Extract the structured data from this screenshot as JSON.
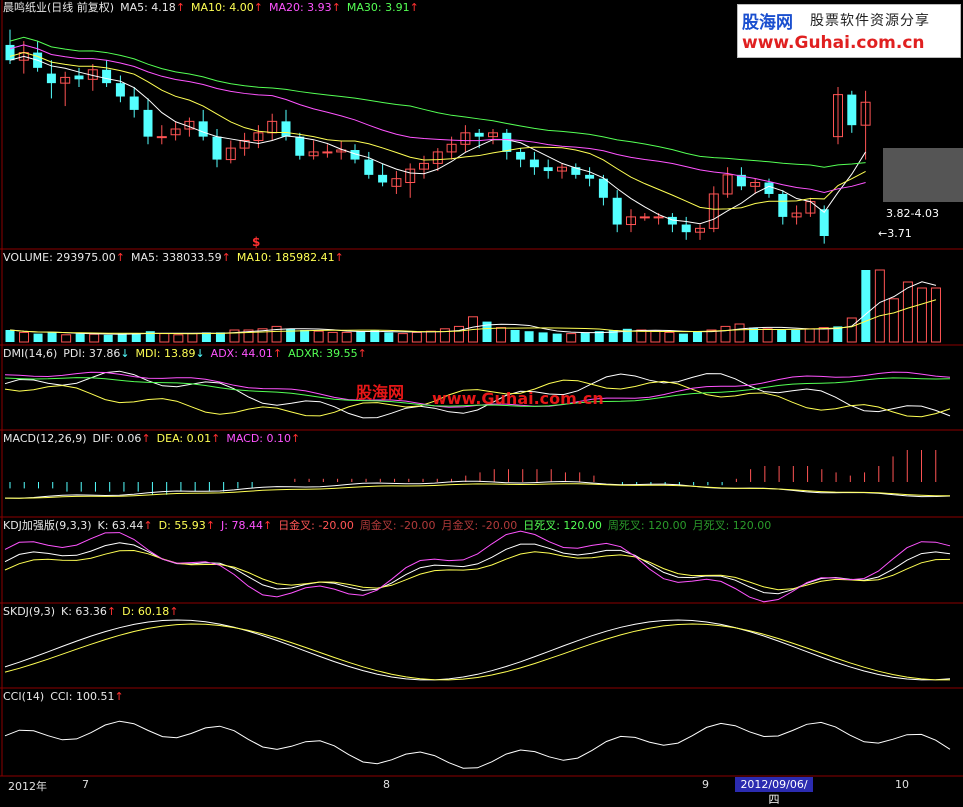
{
  "panels": {
    "main": {
      "items": [
        {
          "text": "晨鸣纸业(日线 前复权)",
          "cls": "c-white"
        },
        {
          "text": "MA5: 4.18",
          "cls": "c-white",
          "arrow": "up"
        },
        {
          "text": "MA10: 4.00",
          "cls": "c-yellow",
          "arrow": "up"
        },
        {
          "text": "MA20: 3.93",
          "cls": "c-magenta",
          "arrow": "up"
        },
        {
          "text": "MA30: 3.91",
          "cls": "c-green",
          "arrow": "up"
        }
      ]
    },
    "volume": {
      "items": [
        {
          "text": "VOLUME: 293975.00",
          "cls": "c-white",
          "arrow": "up"
        },
        {
          "text": "MA5: 338033.59",
          "cls": "c-white",
          "arrow": "up"
        },
        {
          "text": "MA10: 185982.41",
          "cls": "c-yellow",
          "arrow": "up"
        }
      ]
    },
    "dmi": {
      "items": [
        {
          "text": "DMI(14,6)",
          "cls": "c-white"
        },
        {
          "text": "PDI: 37.86",
          "cls": "c-white",
          "arrow": "down"
        },
        {
          "text": "MDI: 13.89",
          "cls": "c-yellow",
          "arrow": "down"
        },
        {
          "text": "ADX: 44.01",
          "cls": "c-magenta",
          "arrow": "up"
        },
        {
          "text": "ADXR: 39.55",
          "cls": "c-green",
          "arrow": "up"
        }
      ]
    },
    "macd": {
      "items": [
        {
          "text": "MACD(12,26,9)",
          "cls": "c-white"
        },
        {
          "text": "DIF: 0.06",
          "cls": "c-white",
          "arrow": "up"
        },
        {
          "text": "DEA: 0.01",
          "cls": "c-yellow",
          "arrow": "up"
        },
        {
          "text": "MACD: 0.10",
          "cls": "c-magenta",
          "arrow": "up"
        }
      ]
    },
    "kdj": {
      "items": [
        {
          "text": "KDJ加强版(9,3,3)",
          "cls": "c-white"
        },
        {
          "text": "K: 63.44",
          "cls": "c-white",
          "arrow": "up"
        },
        {
          "text": "D: 55.93",
          "cls": "c-yellow",
          "arrow": "up"
        },
        {
          "text": "J: 78.44",
          "cls": "c-magenta",
          "arrow": "up"
        },
        {
          "text": "日金叉: -20.00",
          "cls": "c-red"
        },
        {
          "text": "周金叉: -20.00",
          "cls": "c-dred"
        },
        {
          "text": "月金叉: -20.00",
          "cls": "c-dred"
        },
        {
          "text": "日死叉: 120.00",
          "cls": "c-green"
        },
        {
          "text": "周死叉: 120.00",
          "cls": "c-dgreen"
        },
        {
          "text": "月死叉: 120.00",
          "cls": "c-dgreen"
        }
      ]
    },
    "skdj": {
      "items": [
        {
          "text": "SKDJ(9,3)",
          "cls": "c-white"
        },
        {
          "text": "K: 63.36",
          "cls": "c-white",
          "arrow": "up"
        },
        {
          "text": "D: 60.18",
          "cls": "c-yellow",
          "arrow": "up"
        }
      ]
    },
    "cci": {
      "items": [
        {
          "text": "CCI(14)",
          "cls": "c-white"
        },
        {
          "text": "CCI: 100.51",
          "cls": "c-white",
          "arrow": "up"
        }
      ]
    }
  },
  "annotations": {
    "high_low_label": "3.82-4.03",
    "low_label": "3.71",
    "dollar_marker": "$"
  },
  "watermark": {
    "logo_cn": "股海网",
    "logo_tag": "股票软件资源分享",
    "logo_url": "www.Guhai.com.cn",
    "mid_cn": "股海网",
    "mid_url": "www.Guhai.com.cn"
  },
  "x_axis": {
    "labels": [
      "2012年",
      "7",
      "8",
      "9",
      "10"
    ],
    "cursor_date": "2012/09/06/四"
  },
  "colors": {
    "up": "#ff5454",
    "down": "#54ffff",
    "ma5": "#ffffff",
    "ma10": "#ffff54",
    "ma20": "#ff54ff",
    "ma30": "#54ff54",
    "grid": "#8b0000"
  },
  "chart_data": [
    {
      "type": "candlestick",
      "title": "晨鸣纸业(日线 前复权)",
      "ohlc": [
        [
          4.6,
          4.68,
          4.5,
          4.52
        ],
        [
          4.52,
          4.62,
          4.45,
          4.56
        ],
        [
          4.56,
          4.62,
          4.46,
          4.48
        ],
        [
          4.45,
          4.52,
          4.32,
          4.4
        ],
        [
          4.4,
          4.46,
          4.28,
          4.43
        ],
        [
          4.44,
          4.48,
          4.38,
          4.42
        ],
        [
          4.42,
          4.5,
          4.36,
          4.47
        ],
        [
          4.47,
          4.52,
          4.38,
          4.4
        ],
        [
          4.4,
          4.44,
          4.3,
          4.33
        ],
        [
          4.33,
          4.38,
          4.22,
          4.26
        ],
        [
          4.26,
          4.32,
          4.08,
          4.12
        ],
        [
          4.12,
          4.18,
          4.08,
          4.12
        ],
        [
          4.13,
          4.2,
          4.1,
          4.16
        ],
        [
          4.16,
          4.22,
          4.12,
          4.2
        ],
        [
          4.2,
          4.26,
          4.1,
          4.12
        ],
        [
          4.12,
          4.16,
          3.96,
          4.0
        ],
        [
          4.0,
          4.1,
          3.98,
          4.06
        ],
        [
          4.06,
          4.14,
          4.02,
          4.1
        ],
        [
          4.1,
          4.18,
          4.06,
          4.14
        ],
        [
          4.14,
          4.24,
          4.1,
          4.2
        ],
        [
          4.2,
          4.26,
          4.1,
          4.12
        ],
        [
          4.12,
          4.14,
          4.0,
          4.02
        ],
        [
          4.02,
          4.1,
          4.0,
          4.04
        ],
        [
          4.04,
          4.08,
          4.01,
          4.04
        ],
        [
          4.04,
          4.1,
          4.0,
          4.05
        ],
        [
          4.05,
          4.08,
          3.98,
          4.0
        ],
        [
          4.0,
          4.04,
          3.9,
          3.92
        ],
        [
          3.92,
          3.98,
          3.86,
          3.88
        ],
        [
          3.86,
          3.94,
          3.82,
          3.9
        ],
        [
          3.88,
          3.98,
          3.8,
          3.95
        ],
        [
          3.95,
          4.02,
          3.9,
          3.98
        ],
        [
          3.98,
          4.06,
          3.94,
          4.04
        ],
        [
          4.04,
          4.12,
          4.0,
          4.08
        ],
        [
          4.08,
          4.18,
          4.04,
          4.14
        ],
        [
          4.14,
          4.16,
          4.06,
          4.12
        ],
        [
          4.12,
          4.16,
          4.08,
          4.14
        ],
        [
          4.14,
          4.16,
          4.0,
          4.04
        ],
        [
          4.04,
          4.06,
          3.96,
          4.0
        ],
        [
          4.0,
          4.04,
          3.92,
          3.96
        ],
        [
          3.96,
          4.0,
          3.9,
          3.94
        ],
        [
          3.94,
          3.98,
          3.9,
          3.96
        ],
        [
          3.96,
          3.98,
          3.9,
          3.92
        ],
        [
          3.92,
          3.96,
          3.86,
          3.9
        ],
        [
          3.9,
          3.92,
          3.76,
          3.8
        ],
        [
          3.8,
          3.84,
          3.62,
          3.66
        ],
        [
          3.66,
          3.74,
          3.62,
          3.7
        ],
        [
          3.7,
          3.72,
          3.68,
          3.7
        ],
        [
          3.7,
          3.72,
          3.66,
          3.7
        ],
        [
          3.7,
          3.72,
          3.62,
          3.66
        ],
        [
          3.66,
          3.7,
          3.58,
          3.62
        ],
        [
          3.62,
          3.66,
          3.58,
          3.64
        ],
        [
          3.64,
          3.86,
          3.62,
          3.82
        ],
        [
          3.82,
          3.96,
          3.8,
          3.92
        ],
        [
          3.92,
          3.96,
          3.84,
          3.86
        ],
        [
          3.86,
          3.9,
          3.82,
          3.88
        ],
        [
          3.88,
          3.9,
          3.8,
          3.82
        ],
        [
          3.82,
          3.84,
          3.66,
          3.7
        ],
        [
          3.7,
          3.76,
          3.66,
          3.72
        ],
        [
          3.72,
          3.8,
          3.7,
          3.78
        ],
        [
          3.74,
          3.76,
          3.56,
          3.6
        ],
        [
          4.12,
          4.38,
          4.08,
          4.34
        ],
        [
          4.34,
          4.36,
          4.14,
          4.18
        ],
        [
          4.18,
          4.36,
          4.0,
          4.3
        ]
      ],
      "labels": [
        "3.82-4.03",
        "3.71"
      ]
    },
    {
      "type": "bar",
      "title": "VOLUME",
      "values": [
        20,
        16,
        14,
        16,
        12,
        14,
        13,
        12,
        14,
        15,
        18,
        14,
        12,
        14,
        16,
        16,
        20,
        20,
        22,
        26,
        22,
        20,
        18,
        16,
        16,
        18,
        20,
        16,
        14,
        16,
        18,
        22,
        26,
        42,
        34,
        24,
        20,
        18,
        16,
        14,
        14,
        16,
        18,
        20,
        22,
        20,
        18,
        16,
        14,
        18,
        20,
        26,
        30,
        24,
        22,
        20,
        20,
        22,
        24,
        26,
        40,
        120,
        120,
        72,
        100,
        90,
        90
      ]
    },
    {
      "type": "bar",
      "title": "MACD",
      "values": [
        -0.02,
        -0.02,
        -0.02,
        -0.02,
        -0.03,
        -0.03,
        -0.03,
        -0.03,
        -0.03,
        -0.03,
        -0.04,
        -0.04,
        -0.03,
        -0.03,
        -0.03,
        -0.03,
        -0.02,
        -0.02,
        0.0,
        0.0,
        0.01,
        0.01,
        0.01,
        0.01,
        0.01,
        0.01,
        0.01,
        0.01,
        0.01,
        0.01,
        0.01,
        0.01,
        0.02,
        0.03,
        0.04,
        0.04,
        0.04,
        0.04,
        0.04,
        0.03,
        0.03,
        0.02,
        0.0,
        -0.01,
        -0.01,
        -0.01,
        -0.01,
        -0.01,
        -0.01,
        -0.01,
        -0.01,
        0.01,
        0.04,
        0.05,
        0.05,
        0.05,
        0.05,
        0.04,
        0.03,
        0.02,
        0.03,
        0.05,
        0.08,
        0.1,
        0.1,
        0.1
      ]
    }
  ]
}
